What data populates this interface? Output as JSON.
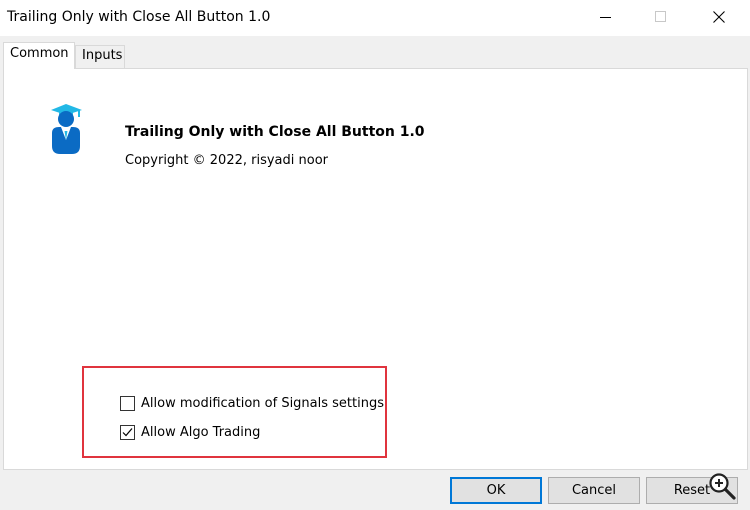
{
  "window": {
    "title": "Trailing Only with Close All Button 1.0"
  },
  "tabs": [
    {
      "label": "Common",
      "active": true
    },
    {
      "label": "Inputs",
      "active": false
    }
  ],
  "info": {
    "name": "Trailing Only with Close All Button 1.0",
    "copyright": "Copyright © 2022, risyadi noor",
    "logo_icon": "graduate-user-icon"
  },
  "options": [
    {
      "label": "Allow modification of Signals settings",
      "checked": false
    },
    {
      "label": "Allow Algo Trading",
      "checked": true
    }
  ],
  "buttons": {
    "ok": "OK",
    "cancel": "Cancel",
    "reset": "Reset"
  },
  "colors": {
    "logo_blue": "#0b6bc4",
    "logo_cyan": "#22b8e6",
    "highlight_red": "#e0343e",
    "default_button_border": "#0078d7"
  }
}
